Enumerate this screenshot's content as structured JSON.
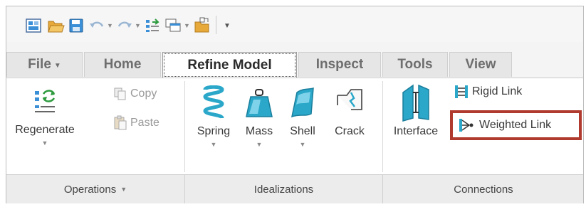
{
  "quick_access": {
    "icons": [
      "window-icon",
      "open-folder-icon",
      "save-icon",
      "undo-icon",
      "redo-icon",
      "regenerate-icon",
      "windows-icon",
      "close-icon",
      "customize-icon"
    ]
  },
  "tabs": [
    {
      "label": "File",
      "has_caret": true
    },
    {
      "label": "Home"
    },
    {
      "label": "Refine Model",
      "active": true
    },
    {
      "label": "Inspect"
    },
    {
      "label": "Tools"
    },
    {
      "label": "View"
    }
  ],
  "ribbon": {
    "operations": {
      "regenerate_label": "Regenerate",
      "copy_label": "Copy",
      "paste_label": "Paste"
    },
    "idealizations": {
      "spring_label": "Spring",
      "mass_label": "Mass",
      "shell_label": "Shell",
      "crack_label": "Crack"
    },
    "connections": {
      "interface_label": "Interface",
      "rigid_link_label": "Rigid Link",
      "weighted_link_label": "Weighted Link"
    }
  },
  "group_labels": {
    "operations": "Operations",
    "idealizations": "Idealizations",
    "connections": "Connections"
  },
  "colors": {
    "highlight_border": "#b03a2e",
    "icon_blue": "#3a8fd6",
    "icon_teal": "#2aa7c9",
    "icon_folder": "#e7a93a"
  }
}
